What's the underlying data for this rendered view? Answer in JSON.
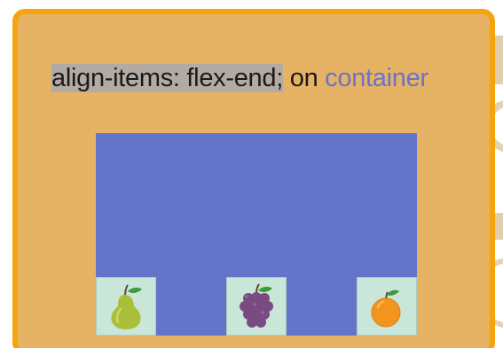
{
  "heading": {
    "code": "align-items: flex-end;",
    "on": "on",
    "target": "container"
  },
  "flex_container": {
    "items": [
      {
        "icon": "pear-icon"
      },
      {
        "icon": "grapes-icon"
      },
      {
        "icon": "orange-icon"
      }
    ]
  },
  "colors": {
    "card_background": "#e6b364",
    "card_border": "#f5a30f",
    "container_background": "#6474c8",
    "item_background": "#c9e6d9",
    "code_highlight": "#b3aaa4",
    "keyword_color": "#6874c8"
  }
}
